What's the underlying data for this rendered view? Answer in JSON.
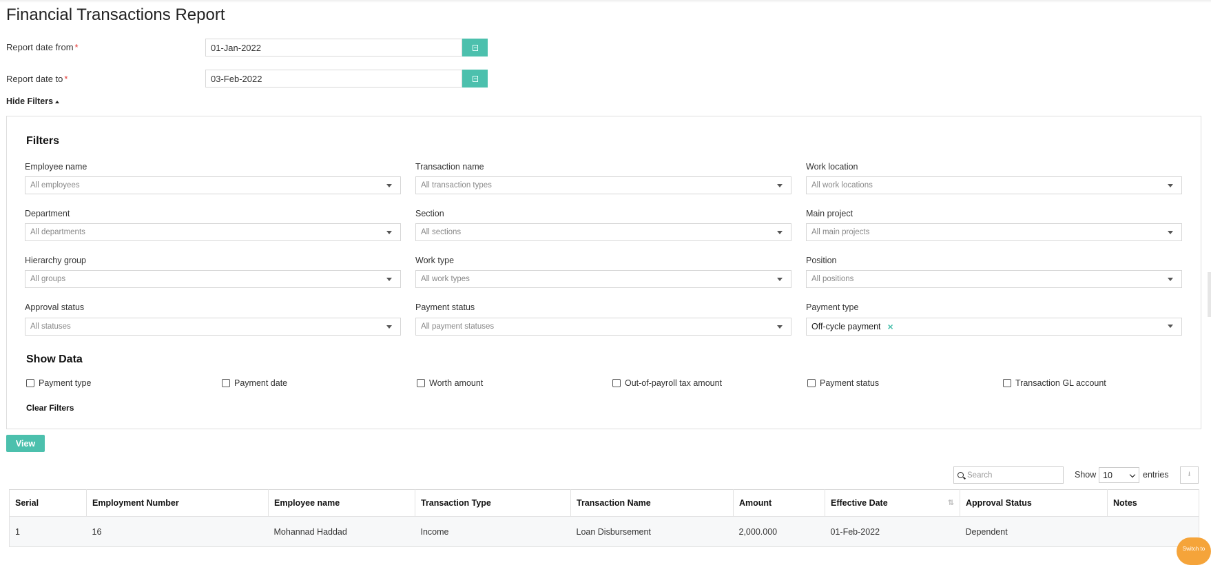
{
  "page": {
    "title": "Financial Transactions Report"
  },
  "dates": {
    "from_label": "Report date from",
    "from_value": "01-Jan-2022",
    "to_label": "Report date to",
    "to_value": "03-Feb-2022",
    "required_mark": "*"
  },
  "toggle": {
    "hide_filters_label": "Hide Filters"
  },
  "filters": {
    "title": "Filters",
    "fields": [
      {
        "label": "Employee name",
        "value": "All employees"
      },
      {
        "label": "Transaction name",
        "value": "All transaction types"
      },
      {
        "label": "Work location",
        "value": "All work locations"
      },
      {
        "label": "Department",
        "value": "All departments"
      },
      {
        "label": "Section",
        "value": "All sections"
      },
      {
        "label": "Main project",
        "value": "All main projects"
      },
      {
        "label": "Hierarchy group",
        "value": "All groups"
      },
      {
        "label": "Work type",
        "value": "All work types"
      },
      {
        "label": "Position",
        "value": "All positions"
      },
      {
        "label": "Approval status",
        "value": "All statuses"
      },
      {
        "label": "Payment status",
        "value": "All payment statuses"
      },
      {
        "label": "Payment type",
        "value": "Off-cycle payment",
        "remove": "×"
      }
    ]
  },
  "show_data": {
    "title": "Show Data",
    "options": [
      "Payment type",
      "Payment date",
      "Worth amount",
      "Out-of-payroll tax amount",
      "Payment status",
      "Transaction GL account"
    ]
  },
  "actions": {
    "clear_filters": "Clear Filters",
    "view": "View"
  },
  "table_controls": {
    "search_placeholder": "Search",
    "show_label": "Show",
    "entries_value": "10",
    "entries_label": "entries"
  },
  "table": {
    "headers": [
      "Serial",
      "Employment Number",
      "Employee name",
      "Transaction Type",
      "Transaction Name",
      "Amount",
      "Effective Date",
      "Approval Status",
      "Notes"
    ],
    "rows": [
      [
        "1",
        "16",
        "Mohannad Haddad",
        "Income",
        "Loan Disbursement",
        "2,000.000",
        "01-Feb-2022",
        "Dependent",
        ""
      ]
    ]
  },
  "floating": {
    "switch_label": "Switch to"
  },
  "colors": {
    "accent": "#4cc0ad",
    "required": "#e53935",
    "bubble": "#f5a43a"
  }
}
